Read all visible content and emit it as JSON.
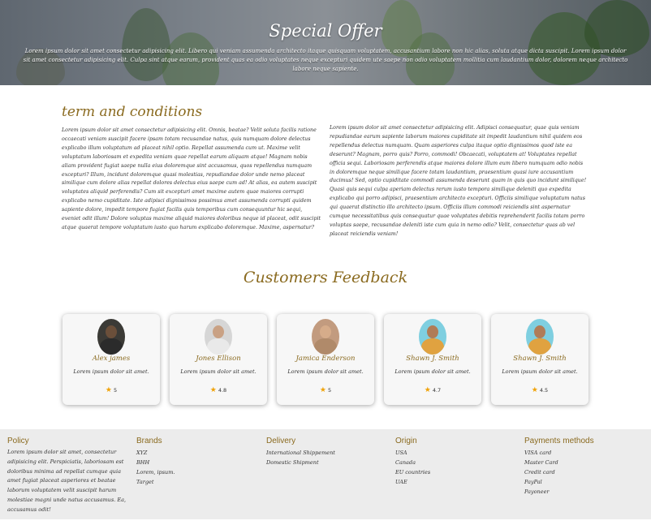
{
  "hero": {
    "title": "Special Offer",
    "text": "Lorem ipsum dolor sit amet consectetur adipisicing elit. Libero qui veniam assumenda architecto itaque quisquam voluptatem, accusantium labore non hic alias, soluta atque dicta suscipit. Lorem ipsum dolor sit amet consectetur adipisicing elit. Culpa sint atque earum, provident quas ea odio voluptates neque excepturi quidem ute saepe non odio voluptatem mollitia cum laudantium dolor, dolorem neque architecto labore neque sapiente."
  },
  "terms": {
    "title": "term and conditions",
    "left": "Lorem ipsum dolor sit amet consectetur adipisicing elit. Omnis, beatae? Velit soluta facilis ratione occaecati veniam suscipit facere ipsam totam recusandae natus, quis numquam dolore delectus explicabo illum voluptatum ad placeat nihil optio. Repellat assumenda cum ut. Maxime velit voluptatum laboriosam et expedita veniam quae repellat earum aliquam atque! Magnam nobis aliam provident fugiat saepe nulla eius doloremque sint accusamus, quos repellendus numquam excepturi? Illum, incidunt doloremque quasi molestias, repudiandae dolor unde nemo placeat similique cum dolore alias repellat dolores delectus eius saepe cum ad! At alias, ea autem suscipit voluptates aliquid perferendis? Cum sit excepturi amet maxime autem quae maiores corrupti explicabo nemo cupiditate. Iste adipisci dignissimos possimus amet assumenda corrupti quidem sapiente dolore, impedit tempore fugiat facilis quis temporibus cum consequuntur hic sequi, eveniet odit illum! Dolore voluptas maxime aliquid maiores doloribus neque id placeat, odit suscipit atque quaerat tempore voluptatum iusto quo harum explicabo doloremque. Maxime, aspernatur?",
    "right": "Lorem ipsum dolor sit amet consectetur adipisicing elit. Adipisci consequatur, quae quis veniam repudiandae earum sapiente laborum maiores cupiditate sit impedit laudantium nihil quidem eos repellendus delectus numquam. Quam asperiores culpa itaque optio dignissimos quod iste ea deserunt? Magnam, porro quis? Porro, commodi! Obcaecati, voluptatem at! Voluptates repellat officia sequi. Laboriosam perferendis atque maiores dolore illum eum libero numquam odio nobis in doloremque neque similique facere totam laudantium, praesentium quasi iure accusantium ducimus! Sed, optio cupiditate commodi assumenda deserunt quam in quis quo incidunt similique! Quasi quis sequi culpa aperiam delectus rerum iusto tempora similique deleniti quo expedita explicabo qui porro adipisci, praesentium architecto excepturi. Officiis similique voluptatum natus qui quaerat distinctio illo architecto ipsum. Officiis illum commodi reiciendis sint aspernatur cumque necessitatibus quis consequatur quae voluptates debitis reprehenderit facilis totam porro voluptas saepe, recusandae deleniti iste cum quia in nemo odio? Velit, consectetur quas ab vel placeat reiciendis veniam!"
  },
  "feedback": {
    "title": "Customers Feedback",
    "cards": [
      {
        "name": "Alex james",
        "text": "Lorem ipsum dolor sit amet.",
        "rating": "5",
        "skin": "#6b4f3a",
        "shirt": "#2b2b2b",
        "bg": "#3b3a36"
      },
      {
        "name": "Jones Ellison",
        "text": "Lorem ipsum dolor sit amet.",
        "rating": "4.8",
        "skin": "#c9a184",
        "shirt": "#e9e9e9",
        "bg": "#d6d6d6"
      },
      {
        "name": "Jamica Enderson",
        "text": "Lorem ipsum dolor sit amet.",
        "rating": "5",
        "skin": "#d6ac8a",
        "shirt": "#b08a6a",
        "bg": "#c29b7f"
      },
      {
        "name": "Shawn J. Smith",
        "text": "Lorem ipsum dolor sit amet.",
        "rating": "4.7",
        "skin": "#b07c57",
        "shirt": "#e0a240",
        "bg": "#7fcfe0"
      },
      {
        "name": "Shawn J. Smith",
        "text": "Lorem ipsum dolor sit amet.",
        "rating": "4.5",
        "skin": "#b07c57",
        "shirt": "#e0a240",
        "bg": "#7fcfe0"
      }
    ]
  },
  "footer": {
    "policy": {
      "title": "Policy",
      "text": "Lorem ipsum dolor sit amet, consectetur adipisicing elit. Perspiciatis, laboriosam est doloribus minima ad repellat cumque quia amet fugiat placeat asperiores et beatae laborum voluptatem velit suscipit harum molestiae magni unde natus accusamus. Ea, accusamus odit!"
    },
    "brands": {
      "title": "Brands",
      "items": [
        "XYZ",
        "BHH",
        "Lorem, ipsum.",
        "Target"
      ]
    },
    "delivery": {
      "title": "Delivery",
      "items": [
        "International Shippement",
        "Domestic Shipment"
      ]
    },
    "origin": {
      "title": "Origin",
      "items": [
        "USA",
        "Canada",
        "EU countries",
        "UAE"
      ]
    },
    "payments": {
      "title": "Payments methods",
      "items": [
        "VISA card",
        "Master Card",
        "Credit card",
        "PayPal",
        "Payoneer"
      ]
    }
  }
}
